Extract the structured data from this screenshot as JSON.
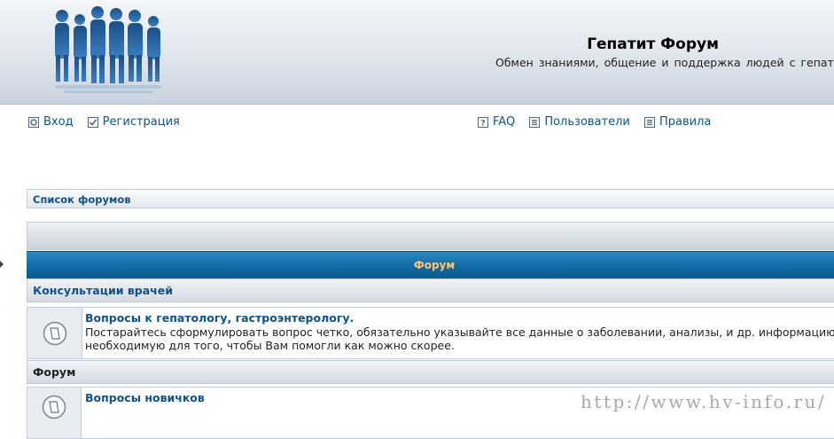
{
  "header": {
    "title": "Гепатит Форум",
    "description": "Обмен знаниями, общение и поддержка людей с гепатитом"
  },
  "nav": {
    "left": [
      {
        "label": "Вход",
        "icon": "login-icon"
      },
      {
        "label": "Регистрация",
        "icon": "register-icon"
      }
    ],
    "right": [
      {
        "label": "FAQ",
        "icon": "faq-icon"
      },
      {
        "label": "Пользователи",
        "icon": "members-icon"
      },
      {
        "label": "Правила",
        "icon": "rules-icon"
      }
    ]
  },
  "breadcrumb": {
    "label": "Список форумов"
  },
  "table": {
    "header": "Форум"
  },
  "categories": [
    {
      "name": "Консультации врачей",
      "forums": [
        {
          "title": "Вопросы к гепатологу, гастроэнтерологу.",
          "description": "Постарайтесь сформулировать вопрос четко, обязательно указывайте все данные о заболевании, анализы, и др. информацию",
          "description2": "необходимую для того, чтобы Вам помогли как можно скорее."
        }
      ]
    },
    {
      "name": "Форум",
      "forums": [
        {
          "title": "Вопросы новичков"
        }
      ]
    }
  ],
  "watermark": "http://www.hv-info.ru/",
  "colors": {
    "link": "#105289",
    "header_blue": "#126ba3",
    "header_text": "#ffc46b"
  }
}
